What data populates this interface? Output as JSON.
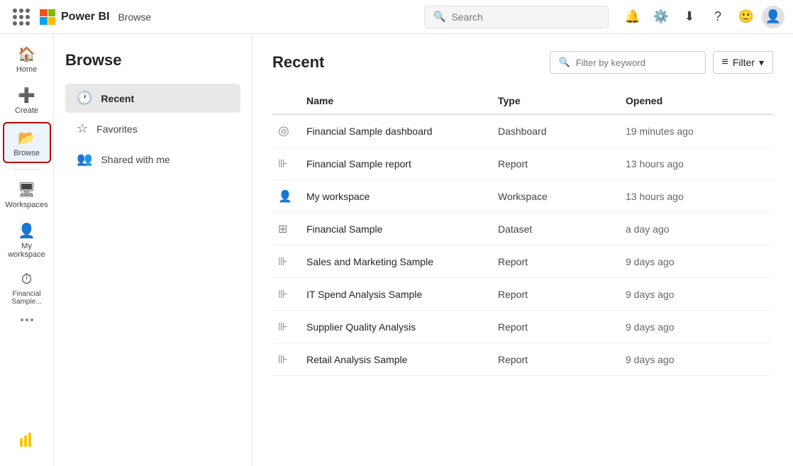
{
  "topnav": {
    "brand": "Power BI",
    "page": "Browse",
    "search_placeholder": "Search"
  },
  "sidebar_nav": {
    "items": [
      {
        "id": "home",
        "label": "Home",
        "icon": "🏠",
        "active": false
      },
      {
        "id": "create",
        "label": "Create",
        "icon": "➕",
        "active": false
      },
      {
        "id": "browse",
        "label": "Browse",
        "icon": "📂",
        "active": true
      },
      {
        "id": "workspaces",
        "label": "Workspaces",
        "icon": "🖥",
        "active": false
      },
      {
        "id": "my-workspace",
        "label": "My workspace",
        "icon": "👤",
        "active": false
      },
      {
        "id": "financial-sample",
        "label": "Financial Sample...",
        "icon": "⏱",
        "active": false
      }
    ],
    "more_label": "..."
  },
  "browse_sidebar": {
    "title": "Browse",
    "menu": [
      {
        "id": "recent",
        "label": "Recent",
        "icon": "🕐",
        "active": true
      },
      {
        "id": "favorites",
        "label": "Favorites",
        "icon": "☆",
        "active": false
      },
      {
        "id": "shared",
        "label": "Shared with me",
        "icon": "👥",
        "active": false
      }
    ]
  },
  "content": {
    "title": "Recent",
    "filter_placeholder": "Filter by keyword",
    "filter_button_label": "Filter",
    "table": {
      "columns": [
        {
          "id": "icon",
          "label": ""
        },
        {
          "id": "name",
          "label": "Name"
        },
        {
          "id": "type",
          "label": "Type"
        },
        {
          "id": "opened",
          "label": "Opened"
        }
      ],
      "rows": [
        {
          "icon": "⊙",
          "name": "Financial Sample dashboard",
          "type": "Dashboard",
          "opened": "19 minutes ago"
        },
        {
          "icon": "📊",
          "name": "Financial Sample report",
          "type": "Report",
          "opened": "13 hours ago"
        },
        {
          "icon": "👤",
          "name": "My workspace",
          "type": "Workspace",
          "opened": "13 hours ago"
        },
        {
          "icon": "⊞",
          "name": "Financial Sample",
          "type": "Dataset",
          "opened": "a day ago"
        },
        {
          "icon": "📊",
          "name": "Sales and Marketing Sample",
          "type": "Report",
          "opened": "9 days ago"
        },
        {
          "icon": "📊",
          "name": "IT Spend Analysis Sample",
          "type": "Report",
          "opened": "9 days ago"
        },
        {
          "icon": "📊",
          "name": "Supplier Quality Analysis",
          "type": "Report",
          "opened": "9 days ago"
        },
        {
          "icon": "📊",
          "name": "Retail Analysis Sample",
          "type": "Report",
          "opened": "9 days ago"
        }
      ]
    }
  }
}
